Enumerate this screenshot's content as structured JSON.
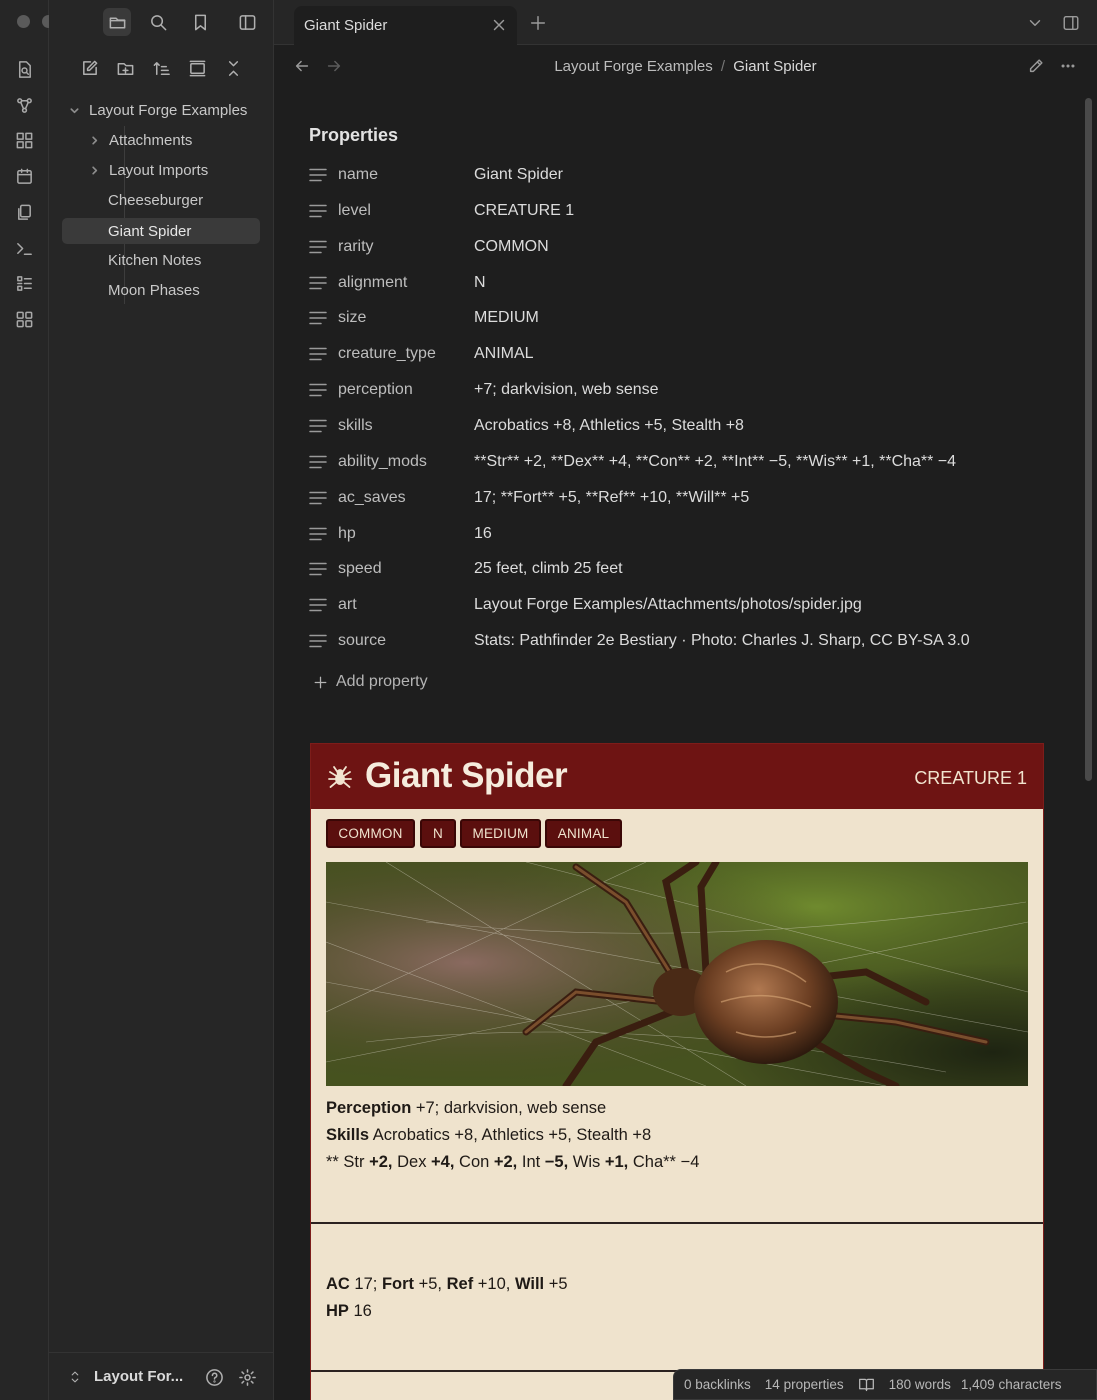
{
  "tabs": [
    {
      "title": "Giant Spider"
    }
  ],
  "sidebar": {
    "vault_name": "Layout For...",
    "tree": [
      {
        "label": "Layout Forge Examples",
        "kind": "folder-open"
      },
      {
        "label": "Attachments",
        "kind": "folder"
      },
      {
        "label": "Layout Imports",
        "kind": "folder"
      },
      {
        "label": "Cheeseburger",
        "kind": "file"
      },
      {
        "label": "Giant Spider",
        "kind": "file",
        "selected": true
      },
      {
        "label": "Kitchen Notes",
        "kind": "file"
      },
      {
        "label": "Moon Phases",
        "kind": "file"
      }
    ]
  },
  "breadcrumb": {
    "folder": "Layout Forge Examples",
    "separator": "/",
    "file": "Giant Spider"
  },
  "properties": {
    "heading": "Properties",
    "rows": [
      {
        "key": "name",
        "value": "Giant Spider"
      },
      {
        "key": "level",
        "value": "CREATURE 1"
      },
      {
        "key": "rarity",
        "value": "COMMON"
      },
      {
        "key": "alignment",
        "value": "N"
      },
      {
        "key": "size",
        "value": "MEDIUM"
      },
      {
        "key": "creature_type",
        "value": "ANIMAL"
      },
      {
        "key": "perception",
        "value": "+7; darkvision, web sense"
      },
      {
        "key": "skills",
        "value": "Acrobatics +8, Athletics +5, Stealth +8"
      },
      {
        "key": "ability_mods",
        "value": "**Str** +2, **Dex** +4, **Con** +2, **Int** −5, **Wis** +1, **Cha** −4"
      },
      {
        "key": "ac_saves",
        "value": "17; **Fort** +5, **Ref** +10, **Will** +5"
      },
      {
        "key": "hp",
        "value": "16"
      },
      {
        "key": "speed",
        "value": "25 feet, climb 25 feet"
      },
      {
        "key": "art",
        "value": "Layout Forge Examples/Attachments/photos/spider.jpg"
      },
      {
        "key": "source",
        "value": "Stats: Pathfinder 2e Bestiary · Photo: Charles J. Sharp, CC BY-SA 3.0"
      }
    ],
    "add_label": "Add property"
  },
  "statblock": {
    "title": "Giant Spider",
    "level": "CREATURE 1",
    "traits": [
      "COMMON",
      "N",
      "MEDIUM",
      "ANIMAL"
    ],
    "perception_label": "Perception",
    "perception_value": " +7; darkvision, web sense",
    "skills_label": "Skills",
    "skills_value": " Acrobatics +8, Athletics +5, Stealth +8",
    "abilities": [
      {
        "t": "** Str ",
        "b": false
      },
      {
        "t": "+2,",
        "b": true
      },
      {
        "t": " Dex ",
        "b": false
      },
      {
        "t": "+4,",
        "b": true
      },
      {
        "t": " Con ",
        "b": false
      },
      {
        "t": "+2,",
        "b": true
      },
      {
        "t": " Int ",
        "b": false
      },
      {
        "t": "−5,",
        "b": true
      },
      {
        "t": " Wis ",
        "b": false
      },
      {
        "t": "+1,",
        "b": true
      },
      {
        "t": " Cha** −4",
        "b": false
      }
    ],
    "ac_label": "AC",
    "ac_value": " 17; ",
    "fort_label": "Fort",
    "fort_value": " +5, ",
    "ref_label": "Ref",
    "ref_value": " +10, ",
    "will_label": "Will",
    "will_value": " +5",
    "hp_label": "HP",
    "hp_value": " 16"
  },
  "status_bar": {
    "backlinks": "0 backlinks",
    "properties": "14 properties",
    "words": "180 words",
    "characters": "1,409 characters"
  },
  "colors": {
    "accent_red": "#6e1413",
    "parchment": "#efe3cd",
    "trait_bg": "#5b0f0e"
  }
}
